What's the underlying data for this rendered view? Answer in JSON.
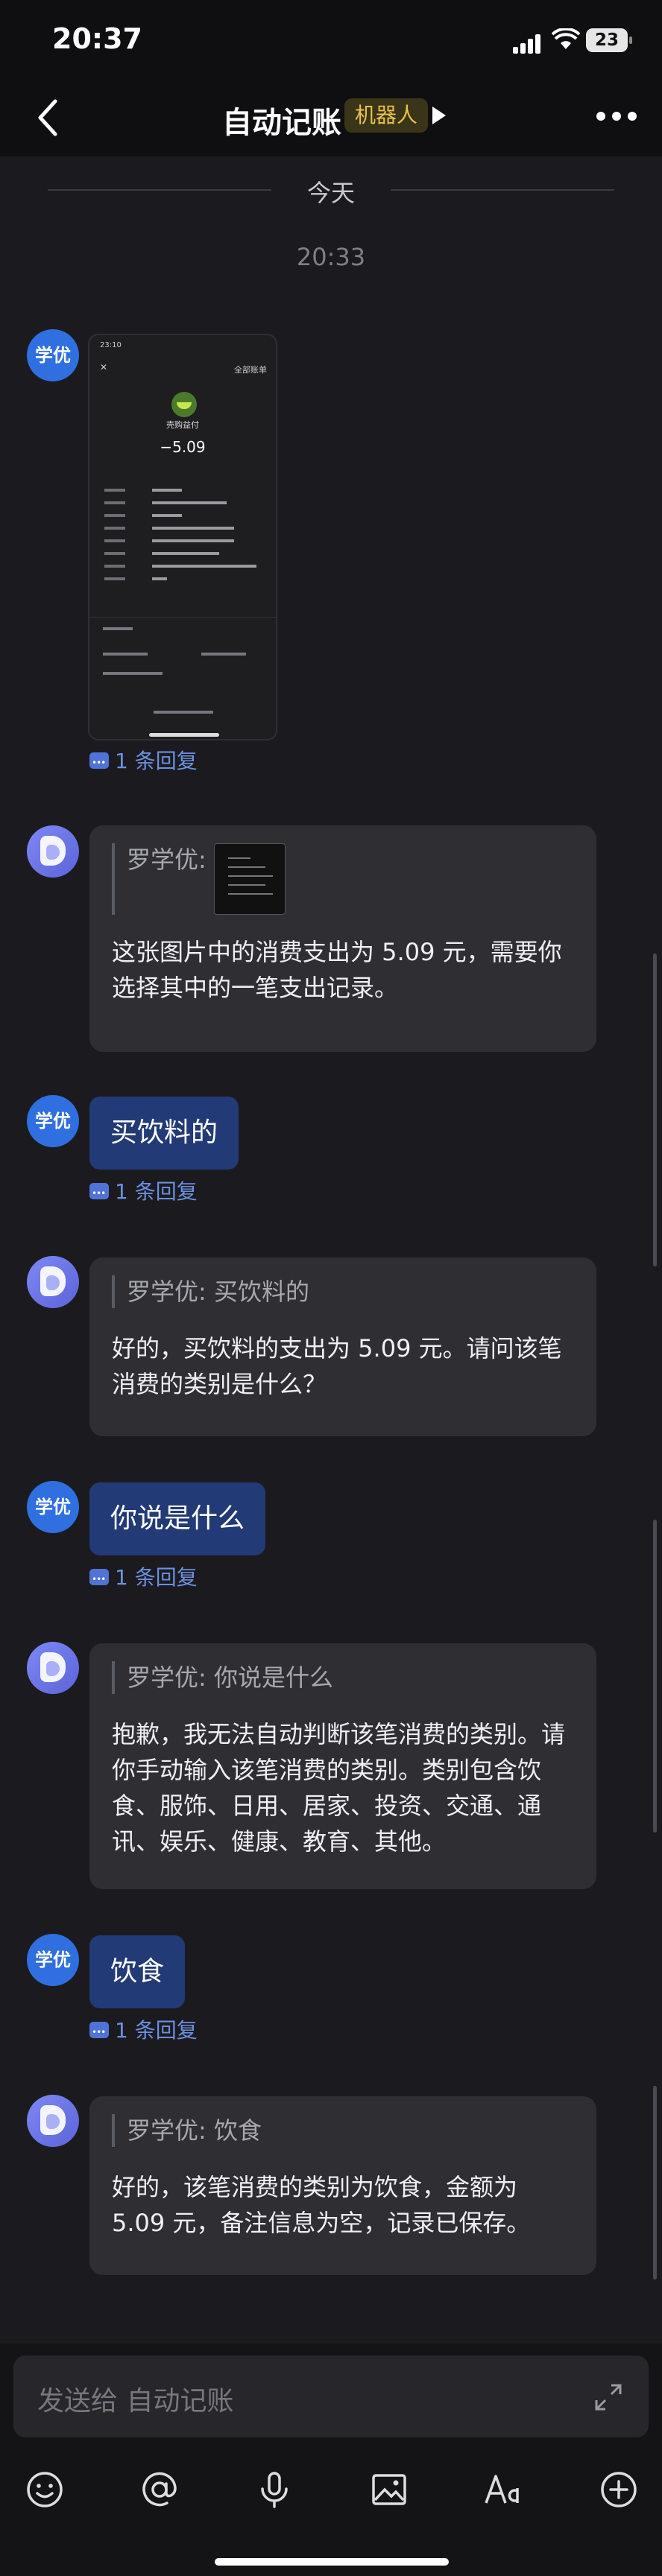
{
  "status": {
    "time": "20:37",
    "battery": "23"
  },
  "nav": {
    "title": "自动记账",
    "tag": "机器人"
  },
  "separator": {
    "today": "今天",
    "timestamp": "20:33"
  },
  "avatars": {
    "user": "学优"
  },
  "receipt": {
    "status_time": "23:10",
    "all_bills": "全部账单",
    "merchant": "壳购益付",
    "amount": "−5.09"
  },
  "messages": [
    {
      "replies": "1 条回复"
    },
    {
      "quote": "罗学优:",
      "text": "这张图片中的消费支出为 5.09 元，需要你选择其中的一笔支出记录。"
    },
    {
      "text": "买饮料的",
      "replies": "1 条回复"
    },
    {
      "quote": "罗学优: 买饮料的",
      "text": "好的，买饮料的支出为 5.09 元。请问该笔消费的类别是什么？"
    },
    {
      "text": "你说是什么",
      "replies": "1 条回复"
    },
    {
      "quote": "罗学优: 你说是什么",
      "text": "抱歉，我无法自动判断该笔消费的类别。请你手动输入该笔消费的类别。类别包含饮食、服饰、日用、居家、投资、交通、通讯、娱乐、健康、教育、其他。"
    },
    {
      "text": "饮食",
      "replies": "1 条回复"
    },
    {
      "quote": "罗学优: 饮食",
      "text": "好的，该笔消费的类别为饮食，金额为 5.09 元，备注信息为空，记录已保存。"
    }
  ],
  "input": {
    "placeholder": "发送给 自动记账"
  },
  "tools": [
    "emoji-icon",
    "mention-icon",
    "microphone-icon",
    "image-icon",
    "font-icon",
    "add-icon"
  ]
}
